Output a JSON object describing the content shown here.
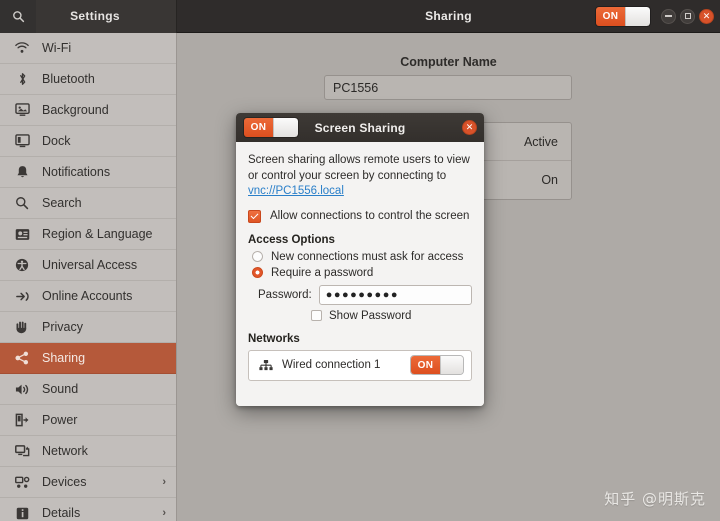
{
  "titlebar": {
    "search_icon": "search-icon",
    "left_title": "Settings",
    "main_title": "Sharing",
    "master_toggle_state": "ON",
    "buttons": {
      "minimize": "−",
      "maximize": "□",
      "close": "✕"
    }
  },
  "sidebar": {
    "items": [
      {
        "label": "Wi-Fi",
        "icon": "wifi-icon",
        "active": false,
        "chevron": ""
      },
      {
        "label": "Bluetooth",
        "icon": "bluetooth-icon",
        "active": false,
        "chevron": ""
      },
      {
        "label": "Background",
        "icon": "background-icon",
        "active": false,
        "chevron": ""
      },
      {
        "label": "Dock",
        "icon": "dock-icon",
        "active": false,
        "chevron": ""
      },
      {
        "label": "Notifications",
        "icon": "bell-icon",
        "active": false,
        "chevron": ""
      },
      {
        "label": "Search",
        "icon": "search-icon",
        "active": false,
        "chevron": ""
      },
      {
        "label": "Region & Language",
        "icon": "region-language-icon",
        "active": false,
        "chevron": ""
      },
      {
        "label": "Universal Access",
        "icon": "accessibility-icon",
        "active": false,
        "chevron": ""
      },
      {
        "label": "Online Accounts",
        "icon": "online-accounts-icon",
        "active": false,
        "chevron": ""
      },
      {
        "label": "Privacy",
        "icon": "privacy-hand-icon",
        "active": false,
        "chevron": ""
      },
      {
        "label": "Sharing",
        "icon": "share-icon",
        "active": true,
        "chevron": ""
      },
      {
        "label": "Sound",
        "icon": "speaker-icon",
        "active": false,
        "chevron": ""
      },
      {
        "label": "Power",
        "icon": "power-plug-icon",
        "active": false,
        "chevron": ""
      },
      {
        "label": "Network",
        "icon": "network-icon",
        "active": false,
        "chevron": ""
      },
      {
        "label": "Devices",
        "icon": "devices-icon",
        "active": false,
        "chevron": "›"
      },
      {
        "label": "Details",
        "icon": "info-icon",
        "active": false,
        "chevron": "›"
      }
    ]
  },
  "main": {
    "computer_name_label": "Computer Name",
    "computer_name_value": "PC1556",
    "background_rows": [
      {
        "value": "Active"
      },
      {
        "value": "On"
      }
    ]
  },
  "dialog": {
    "title": "Screen Sharing",
    "toggle_state": "ON",
    "close_label": "✕",
    "description_prefix": "Screen sharing allows remote users to view or control your screen by connecting to ",
    "description_link": "vnc://PC1556.local",
    "allow_control_label": "Allow connections to control the screen",
    "allow_control_checked": true,
    "access_options_title": "Access Options",
    "radio_ask_label": "New connections must ask for access",
    "radio_ask_selected": false,
    "radio_password_label": "Require a password",
    "radio_password_selected": true,
    "password_label": "Password:",
    "password_value": "●●●●●●●●●",
    "show_password_label": "Show Password",
    "show_password_checked": false,
    "networks_title": "Networks",
    "networks": [
      {
        "name": "Wired connection 1",
        "toggle_state": "ON",
        "icon": "wired-network-icon"
      }
    ]
  },
  "watermark": {
    "text": "知乎 @明斯克"
  },
  "colors": {
    "accent_orange": "#e2562a",
    "sidebar_active": "#b5593a",
    "titlebar_dark": "#2f2c2b",
    "link_blue": "#2a7fc9",
    "window_bg": "#aeaaa6"
  }
}
